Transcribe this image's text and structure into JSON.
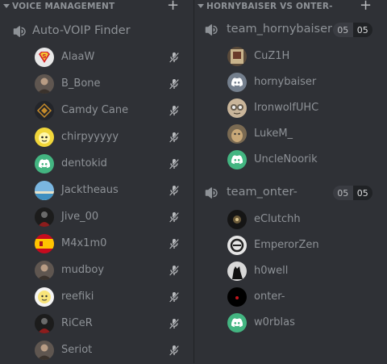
{
  "left": {
    "category": {
      "title": "VOICE MANAGEMENT",
      "chevron_icon": "chevron-down-icon",
      "add_icon": "plus-icon",
      "add_label": "+"
    },
    "channel": {
      "name": "Auto-VOIP Finder",
      "icon": "speaker-icon"
    },
    "users": [
      {
        "name": "AlaaW",
        "avatar": "superman-logo",
        "muted": true
      },
      {
        "name": "B_Bone",
        "avatar": "photo",
        "muted": true
      },
      {
        "name": "Camdy Cane",
        "avatar": "diamond-logo",
        "muted": true
      },
      {
        "name": "chirpyyyyy",
        "avatar": "yellow-cartoon",
        "muted": true
      },
      {
        "name": "dentokid",
        "avatar": "discord-default",
        "muted": true
      },
      {
        "name": "Jacktheaus",
        "avatar": "sky-photo",
        "muted": true
      },
      {
        "name": "Jive_00",
        "avatar": "dark-figure",
        "muted": true
      },
      {
        "name": "M4x1m0",
        "avatar": "spain-flag",
        "muted": true
      },
      {
        "name": "mudboy",
        "avatar": "photo",
        "muted": true
      },
      {
        "name": "reefiki",
        "avatar": "white-face",
        "muted": true
      },
      {
        "name": "RiCeR",
        "avatar": "dark-figure",
        "muted": true
      },
      {
        "name": "Seriot",
        "avatar": "photo",
        "muted": true
      }
    ]
  },
  "right": {
    "category": {
      "title": "HORNYBAISER VS ONTER-",
      "chevron_icon": "chevron-down-icon",
      "add_icon": "plus-icon",
      "add_label": "+"
    },
    "channels": [
      {
        "name": "team_hornybaiser",
        "icon": "speaker-icon",
        "limit_current": "05",
        "limit_max": "05",
        "users": [
          {
            "name": "CuZ1H",
            "avatar": "poster"
          },
          {
            "name": "hornybaiser",
            "avatar": "discord-default-grey"
          },
          {
            "name": "IronwolfUHC",
            "avatar": "goggles-face"
          },
          {
            "name": "LukeM_",
            "avatar": "cat-photo"
          },
          {
            "name": "UncleNoorik",
            "avatar": "discord-default"
          }
        ]
      },
      {
        "name": "team_onter-",
        "icon": "speaker-icon",
        "limit_current": "05",
        "limit_max": "05",
        "users": [
          {
            "name": "eClutchh",
            "avatar": "dark-photo"
          },
          {
            "name": "EmperorZen",
            "avatar": "circle-logo"
          },
          {
            "name": "h0well",
            "avatar": "wolf-silhouette"
          },
          {
            "name": "onter-",
            "avatar": "black-red-dot"
          },
          {
            "name": "w0rblas",
            "avatar": "discord-default"
          }
        ]
      }
    ]
  },
  "colors": {
    "background": "#2f3136",
    "text_muted": "#8e9297",
    "discord_green": "#43b581",
    "discord_grey": "#747f8d"
  }
}
